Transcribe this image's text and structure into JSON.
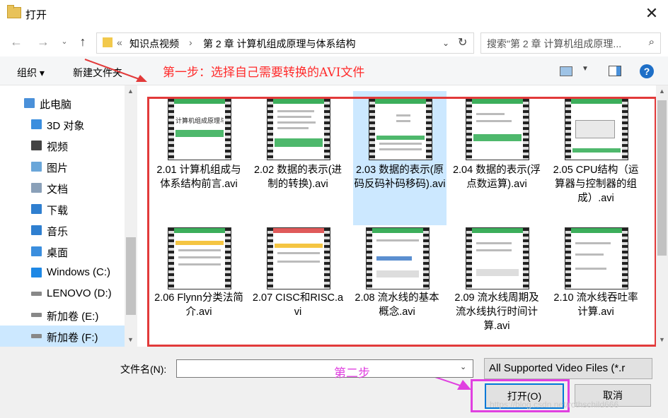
{
  "window": {
    "title": "打开",
    "close": "✕"
  },
  "address": {
    "path_prefix": "«",
    "crumbs": [
      "知识点视频",
      "第 2 章 计算机组成原理与体系结构"
    ],
    "separator": "›",
    "search_placeholder": "搜索\"第 2 章 计算机组成原理..."
  },
  "toolbar": {
    "organize": "组织 ▾",
    "new_folder": "新建文件夹",
    "help": "?"
  },
  "annotations": {
    "step1": "第一步：选择自己需要转换的AVI文件",
    "step2": "第二步",
    "color_red": "#e23a3a",
    "color_magenta": "#e040e0"
  },
  "nav": {
    "items": [
      {
        "label": "此电脑",
        "icon": "computer-icon",
        "color": "#4a90d9"
      },
      {
        "label": "3D 对象",
        "icon": "3d-objects-icon",
        "color": "#3b8ede"
      },
      {
        "label": "视频",
        "icon": "videos-icon",
        "color": "#444444"
      },
      {
        "label": "图片",
        "icon": "pictures-icon",
        "color": "#6aa6d9"
      },
      {
        "label": "文档",
        "icon": "documents-icon",
        "color": "#8aa0b8"
      },
      {
        "label": "下载",
        "icon": "downloads-icon",
        "color": "#2f7fd0"
      },
      {
        "label": "音乐",
        "icon": "music-icon",
        "color": "#2f7fd0"
      },
      {
        "label": "桌面",
        "icon": "desktop-icon",
        "color": "#3b8ede"
      },
      {
        "label": "Windows (C:)",
        "icon": "windows-drive-icon",
        "color": "#1e88e5"
      },
      {
        "label": "LENOVO (D:)",
        "icon": "drive-icon",
        "color": "#888888"
      },
      {
        "label": "新加卷 (E:)",
        "icon": "drive-icon",
        "color": "#888888"
      },
      {
        "label": "新加卷 (F:)",
        "icon": "drive-icon",
        "color": "#888888"
      }
    ]
  },
  "files": [
    {
      "name": "2.01  计算机组成与体系结构前言.avi",
      "thumb_text": "计算机组成原理与体系结构"
    },
    {
      "name": "2.02  数据的表示(进制的转换).avi",
      "thumb_text": ""
    },
    {
      "name": "2.03  数据的表示(原码反码补码移码).avi",
      "thumb_text": "",
      "selected": true
    },
    {
      "name": "2.04  数据的表示(浮点数运算).avi",
      "thumb_text": ""
    },
    {
      "name": "2.05  CPU结构（运算器与控制器的组成）.avi",
      "thumb_text": ""
    },
    {
      "name": "2.06  Flynn分类法简介.avi",
      "thumb_text": ""
    },
    {
      "name": "2.07  CISC和RISC.avi",
      "thumb_text": ""
    },
    {
      "name": "2.08  流水线的基本概念.avi",
      "thumb_text": ""
    },
    {
      "name": "2.09  流水线周期及流水线执行时间计算.avi",
      "thumb_text": ""
    },
    {
      "name": "2.10  流水线吞吐率计算.avi",
      "thumb_text": ""
    }
  ],
  "bottom": {
    "filename_label": "文件名(N):",
    "filename_value": "",
    "filetype": "All Supported Video Files (*.r",
    "open": "打开(O)",
    "cancel": "取消"
  },
  "watermark": "https://blog.csdn.net/rothschild666"
}
